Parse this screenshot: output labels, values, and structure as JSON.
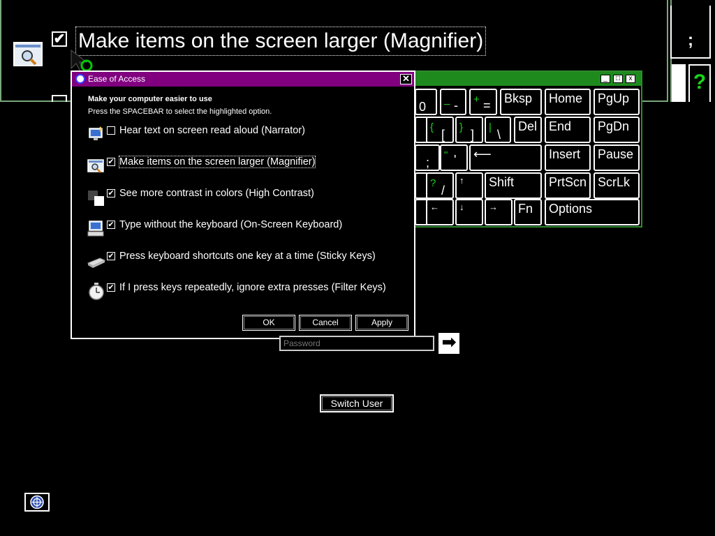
{
  "magnifier": {
    "label": "Make items on the screen larger (Magnifier)",
    "checkmark": "✔",
    "side_key_top": ";",
    "side_key_help": "?"
  },
  "osk": {
    "window_buttons": [
      "_",
      "□",
      "x"
    ],
    "keys": [
      {
        "id": "0",
        "top_glyph": ")",
        "main": "0"
      },
      {
        "id": "minus",
        "top_glyph": "_",
        "main": "-"
      },
      {
        "id": "equals",
        "top_glyph": "+",
        "main": "="
      },
      {
        "id": "bksp",
        "main": "Bksp"
      },
      {
        "id": "home",
        "main": "Home"
      },
      {
        "id": "pgup",
        "main": "PgUp"
      },
      {
        "id": "lbracket",
        "top_glyph": "{",
        "main": "["
      },
      {
        "id": "rbracket",
        "top_glyph": "}",
        "main": "]"
      },
      {
        "id": "backslash",
        "top_glyph": "|",
        "main": "\\"
      },
      {
        "id": "del",
        "main": "Del"
      },
      {
        "id": "end",
        "main": "End"
      },
      {
        "id": "pgdn",
        "main": "PgDn"
      },
      {
        "id": "semicolon",
        "top_glyph": ":",
        "main": ";"
      },
      {
        "id": "quote",
        "top_glyph": "\"",
        "main": "'"
      },
      {
        "id": "enter",
        "main": "⟵"
      },
      {
        "id": "insert",
        "main": "Insert"
      },
      {
        "id": "pause",
        "main": "Pause"
      },
      {
        "id": "slash",
        "top_glyph": "?",
        "main": "/"
      },
      {
        "id": "up",
        "main": "↑"
      },
      {
        "id": "shift",
        "main": "Shift"
      },
      {
        "id": "prtscn",
        "main": "PrtScn"
      },
      {
        "id": "scrlk",
        "main": "ScrLk"
      },
      {
        "id": "left",
        "main": "←"
      },
      {
        "id": "down",
        "main": "↓"
      },
      {
        "id": "right",
        "main": "→"
      },
      {
        "id": "fn",
        "main": "Fn"
      },
      {
        "id": "options",
        "main": "Options"
      }
    ]
  },
  "dialog": {
    "title": "Ease of Access",
    "close": "✕",
    "heading": "Make your computer easier to use",
    "subheading": "Press the SPACEBAR to select the highlighted option.",
    "options": [
      {
        "icon": "narrator-icon",
        "checked": false,
        "label": "Hear text on screen read aloud (Narrator)"
      },
      {
        "icon": "magnifier-icon",
        "checked": true,
        "label": "Make items on the screen larger (Magnifier)"
      },
      {
        "icon": "high-contrast-icon",
        "checked": true,
        "label": "See more contrast in colors (High Contrast)"
      },
      {
        "icon": "on-screen-keyboard-icon",
        "checked": true,
        "label": "Type without the keyboard (On-Screen Keyboard)"
      },
      {
        "icon": "sticky-keys-icon",
        "checked": true,
        "label": "Press keyboard shortcuts one key at a time (Sticky Keys)"
      },
      {
        "icon": "filter-keys-icon",
        "checked": true,
        "label": "If I press keys repeatedly, ignore extra presses (Filter Keys)"
      }
    ],
    "check_glyph": "✔",
    "ok": "OK",
    "cancel": "Cancel",
    "apply": "Apply"
  },
  "logon": {
    "password_placeholder": "Password",
    "go_arrow": "➡",
    "switch_user": "Switch User"
  },
  "colors": {
    "accent_green": "#19d419",
    "dialog_titlebar": "#800080",
    "osk_titlebar": "#1e8a1e"
  }
}
